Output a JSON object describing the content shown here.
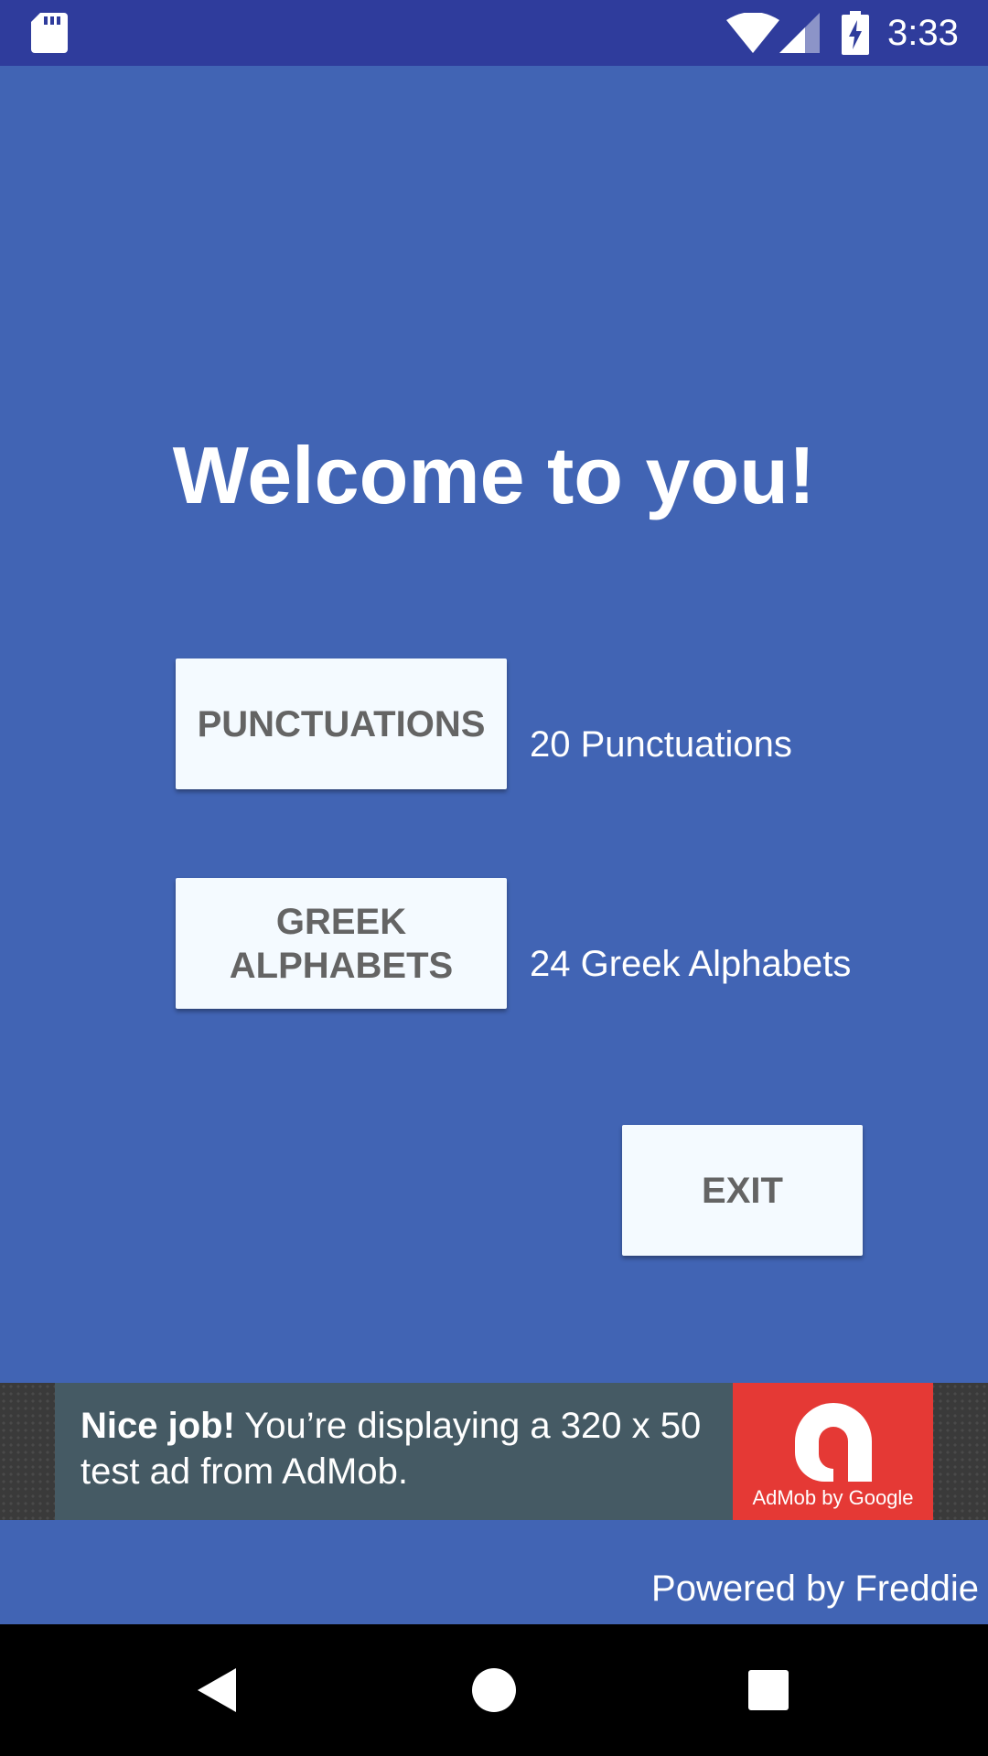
{
  "status_bar": {
    "time": "3:33",
    "icons": [
      "sd-card-icon",
      "wifi-icon",
      "signal-icon",
      "battery-charging-icon"
    ]
  },
  "main": {
    "title": "Welcome to you!",
    "buttons": {
      "punctuations": "PUNCTUATIONS",
      "greek_alphabets": "GREEK ALPHABETS",
      "exit": "EXIT"
    },
    "descriptions": {
      "punctuations": "20 Punctuations",
      "greek_alphabets": "24 Greek Alphabets"
    }
  },
  "ad": {
    "headline": "Nice job!",
    "body": " You’re displaying a 320 x 50 test ad from AdMob.",
    "logo_text": "AdMob by Google"
  },
  "footer": {
    "powered_by": "Powered by Freddie"
  },
  "nav_bar": {
    "icons": [
      "back-icon",
      "home-icon",
      "recents-icon"
    ]
  },
  "colors": {
    "background": "#4164b4",
    "status_bar": "#2f3c9c",
    "button_bg": "#f4faff",
    "button_text": "#646464",
    "ad_bg": "#455a64",
    "ad_logo": "#e53935"
  }
}
